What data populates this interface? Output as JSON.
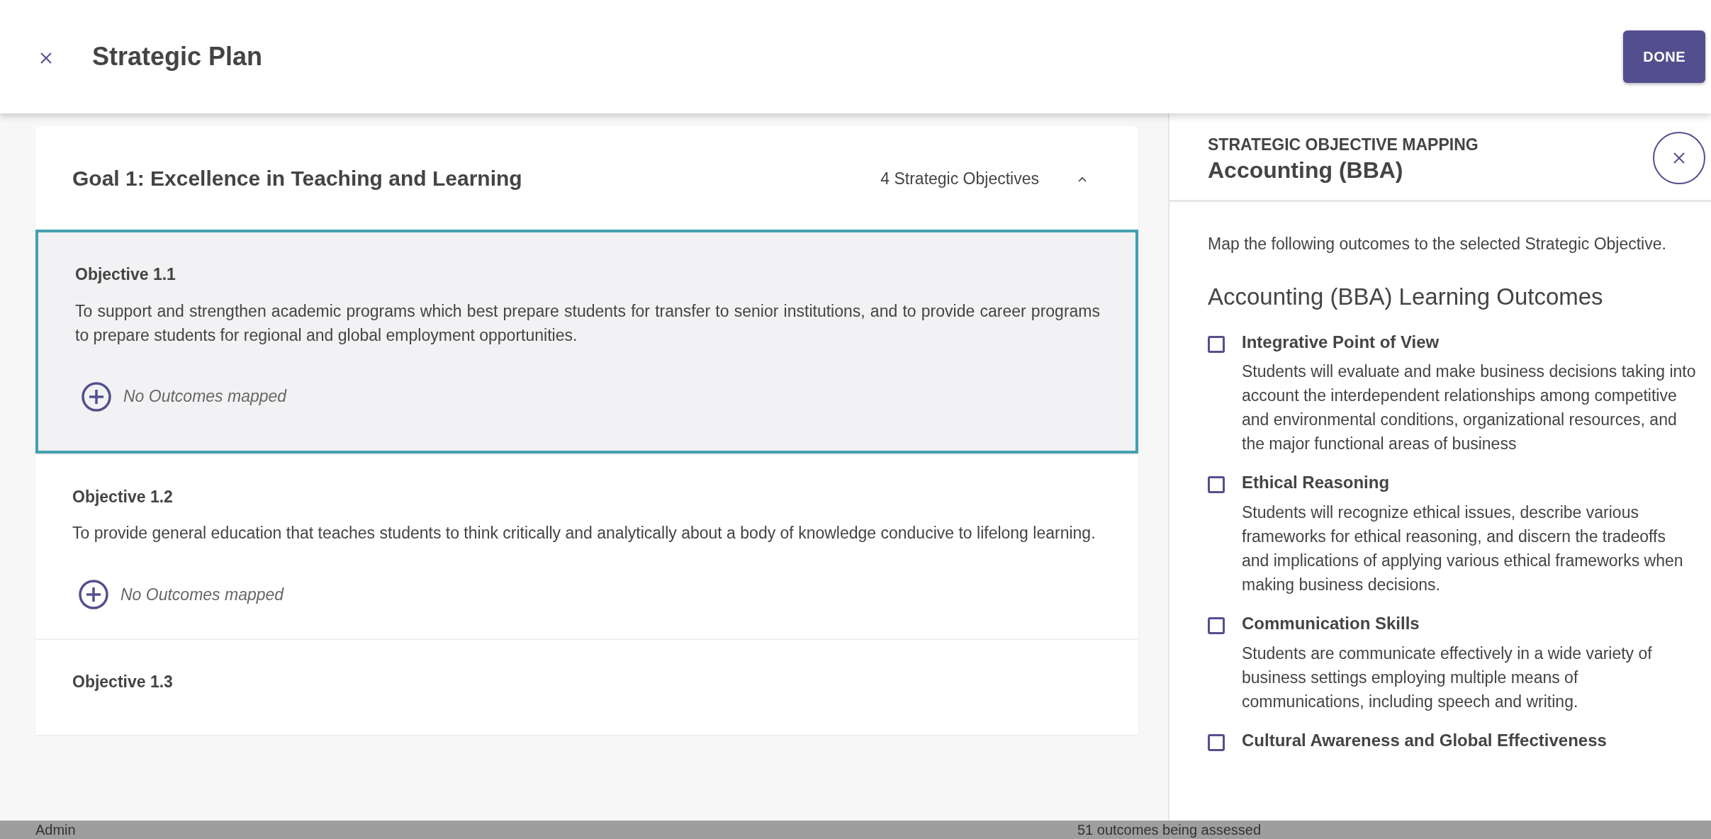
{
  "header": {
    "title": "Strategic Plan",
    "done_label": "DONE"
  },
  "goal": {
    "title": "Goal 1: Excellence in Teaching and Learning",
    "count": "4 Strategic Objectives",
    "expanded": true,
    "objectives": [
      {
        "title": "Objective 1.1",
        "text": "To support and strengthen academic programs which best prepare students for transfer to senior institutions, and to provide career programs to prepare students for regional and global employment opportunities.",
        "outcomes": "No Outcomes mapped",
        "selected": true
      },
      {
        "title": "Objective 1.2",
        "text": "To provide general education that teaches students to think critically and analytically about a body of knowledge conducive to lifelong learning.",
        "outcomes": "No Outcomes mapped",
        "selected": false
      },
      {
        "title": "Objective 1.3",
        "selected": false
      }
    ]
  },
  "mapping_panel": {
    "eyebrow": "STRATEGIC OBJECTIVE MAPPING",
    "title": "Accounting (BBA)",
    "intro": "Map the following outcomes to the selected Strategic Objective.",
    "heading": "Accounting (BBA) Learning Outcomes",
    "outcomes": [
      {
        "title": "Integrative Point of View",
        "description": "Students will evaluate and make business decisions taking into account the interdependent relationships among competitive and environmental conditions, organizational resources, and the major functional areas of business",
        "checked": false
      },
      {
        "title": "Ethical Reasoning",
        "description": "Students will recognize ethical issues, describe various frameworks for ethical reasoning, and discern the tradeoffs and implications of applying various ethical frameworks when making business decisions.",
        "checked": false
      },
      {
        "title": "Communication Skills",
        "description": "Students are communicate effectively in a wide variety of business settings employing multiple means of communications, including speech and writing.",
        "checked": false
      },
      {
        "title": "Cultural Awareness and Global Effectiveness",
        "checked": false
      }
    ]
  },
  "status_bar": {
    "user": "Admin",
    "summary": "51 outcomes being assessed"
  }
}
